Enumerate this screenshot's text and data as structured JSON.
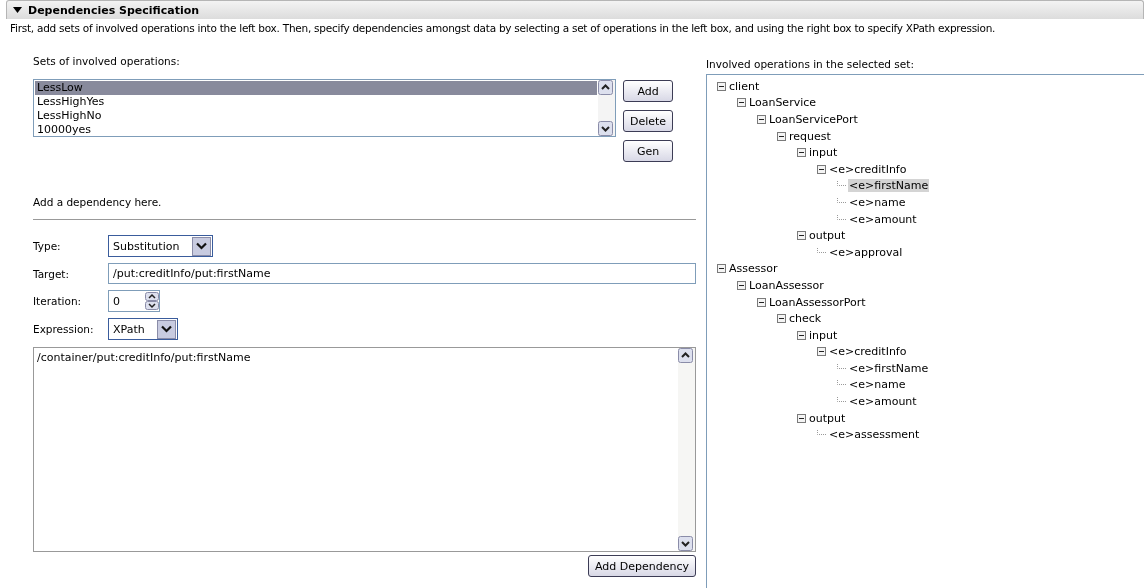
{
  "section": {
    "title": "Dependencies Specification",
    "expanded": true,
    "description": "First, add sets of involved operations into the left box. Then, specify dependencies amongst data by selecting a set of operations in the left box, and using the right box to specify XPath expression."
  },
  "sets": {
    "label": "Sets of involved operations:",
    "items": [
      {
        "label": "LessLow",
        "selected": true
      },
      {
        "label": "LessHighYes",
        "selected": false
      },
      {
        "label": "LessHighNo",
        "selected": false
      },
      {
        "label": "10000yes",
        "selected": false
      }
    ],
    "buttons": [
      "Add",
      "Delete",
      "Gen"
    ]
  },
  "dependency": {
    "heading": "Add a dependency here.",
    "type": {
      "label": "Type:",
      "value": "Substitution"
    },
    "target": {
      "label": "Target:",
      "value": "/put:creditInfo/put:firstName"
    },
    "iteration": {
      "label": "Iteration:",
      "value": "0"
    },
    "expression": {
      "label": "Expression:",
      "value": "XPath"
    },
    "expression_text": "/container/put:creditInfo/put:firstName",
    "button": "Add Dependency"
  },
  "operations": {
    "label": "Involved operations in the selected set:",
    "tree": [
      {
        "label": "client",
        "expanded": true,
        "selected": false,
        "children": [
          {
            "label": "LoanService",
            "expanded": true,
            "selected": false,
            "children": [
              {
                "label": "LoanServicePort",
                "expanded": true,
                "selected": false,
                "children": [
                  {
                    "label": "request",
                    "expanded": true,
                    "selected": false,
                    "children": [
                      {
                        "label": "input",
                        "expanded": true,
                        "selected": false,
                        "children": [
                          {
                            "label": "<e>creditInfo",
                            "expanded": true,
                            "selected": false,
                            "children": [
                              {
                                "label": "<e>firstName",
                                "selected": true
                              },
                              {
                                "label": "<e>name",
                                "selected": false
                              },
                              {
                                "label": "<e>amount",
                                "selected": false
                              }
                            ]
                          }
                        ]
                      },
                      {
                        "label": "output",
                        "expanded": true,
                        "selected": false,
                        "children": [
                          {
                            "label": "<e>approval",
                            "selected": false
                          }
                        ]
                      }
                    ]
                  }
                ]
              }
            ]
          }
        ]
      },
      {
        "label": "Assessor",
        "expanded": true,
        "selected": false,
        "children": [
          {
            "label": "LoanAssessor",
            "expanded": true,
            "selected": false,
            "children": [
              {
                "label": "LoanAssessorPort",
                "expanded": true,
                "selected": false,
                "children": [
                  {
                    "label": "check",
                    "expanded": true,
                    "selected": false,
                    "children": [
                      {
                        "label": "input",
                        "expanded": true,
                        "selected": false,
                        "children": [
                          {
                            "label": "<e>creditInfo",
                            "expanded": true,
                            "selected": false,
                            "children": [
                              {
                                "label": "<e>firstName",
                                "selected": false
                              },
                              {
                                "label": "<e>name",
                                "selected": false
                              },
                              {
                                "label": "<e>amount",
                                "selected": false
                              }
                            ]
                          }
                        ]
                      },
                      {
                        "label": "output",
                        "expanded": true,
                        "selected": false,
                        "children": [
                          {
                            "label": "<e>assessment",
                            "selected": false
                          }
                        ]
                      }
                    ]
                  }
                ]
              }
            ]
          }
        ]
      }
    ]
  }
}
